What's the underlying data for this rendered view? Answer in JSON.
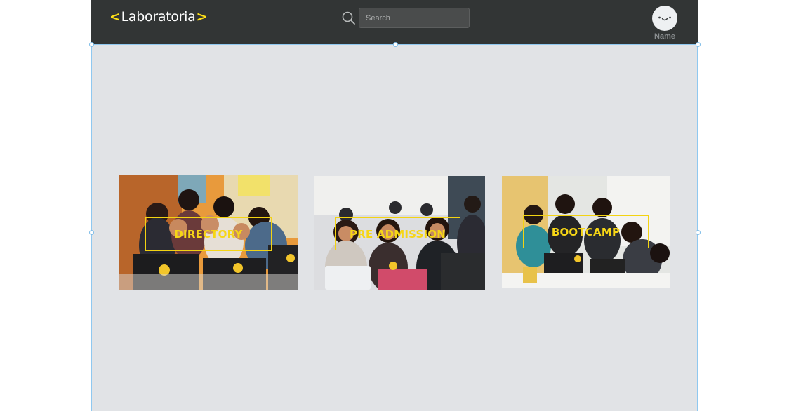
{
  "header": {
    "logo": {
      "left_chevron": "<",
      "word": "Laboratoria",
      "right_chevron": ">"
    },
    "search": {
      "placeholder": "Search",
      "icon": "search-icon"
    },
    "user": {
      "avatar_icon": "smiley-face-icon",
      "name": "Name"
    }
  },
  "main": {
    "cards": [
      {
        "label": "DIRECTORY",
        "image": "students-with-laptops-photo"
      },
      {
        "label": "PRE ADMISSION",
        "image": "students-in-classroom-photo"
      },
      {
        "label": "BOOTCAMP",
        "image": "students-working-together-photo"
      }
    ]
  },
  "colors": {
    "topbar": "#323535",
    "accent": "#ffe017",
    "canvas": "#e1e3e6",
    "selection": "#8fc8f0"
  }
}
